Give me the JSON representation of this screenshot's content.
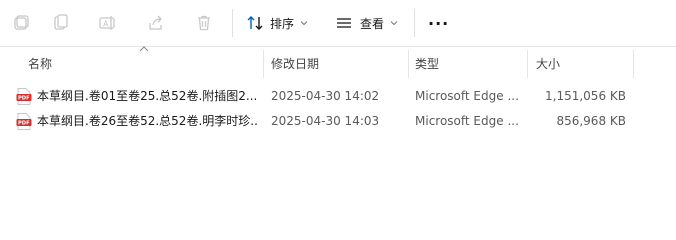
{
  "toolbar": {
    "icons": [
      "new-icon",
      "copy-icon",
      "rename-icon",
      "share-icon",
      "delete-icon"
    ],
    "sort_label": "排序",
    "view_label": "查看",
    "more_label": "···"
  },
  "columns": {
    "name": "名称",
    "date": "修改日期",
    "type": "类型",
    "size": "大小"
  },
  "files": [
    {
      "icon": "pdf-icon",
      "name": "本草纲目.卷01至卷25.总52卷.附插图2...",
      "date": "2025-04-30 14:02",
      "type": "Microsoft Edge ...",
      "size": "1,151,056 KB"
    },
    {
      "icon": "pdf-icon",
      "name": "本草纲目.卷26至卷52.总52卷.明李时珍...",
      "date": "2025-04-30 14:03",
      "type": "Microsoft Edge ...",
      "size": "856,968 KB"
    }
  ],
  "colors": {
    "icon_disabled": "#c8c8c8",
    "accent": "#005fb8",
    "pdf_red": "#d32f2f"
  }
}
